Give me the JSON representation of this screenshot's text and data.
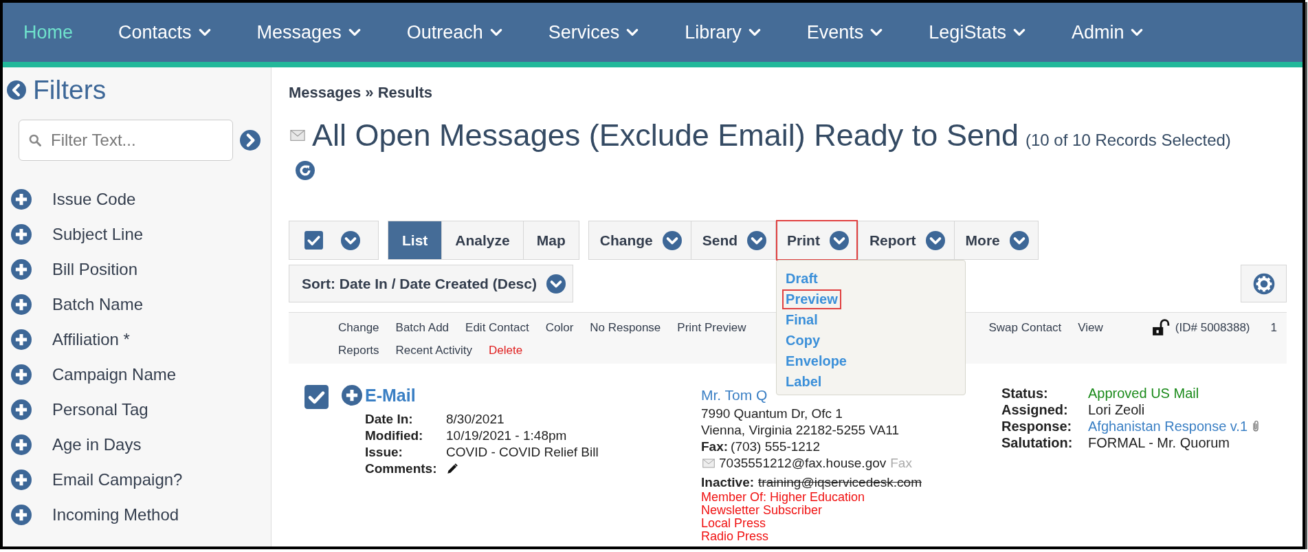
{
  "nav": [
    {
      "label": "Home",
      "selected": true,
      "dropdown": false
    },
    {
      "label": "Contacts",
      "selected": false,
      "dropdown": true
    },
    {
      "label": "Messages",
      "selected": false,
      "dropdown": true
    },
    {
      "label": "Outreach",
      "selected": false,
      "dropdown": true
    },
    {
      "label": "Services",
      "selected": false,
      "dropdown": true
    },
    {
      "label": "Library",
      "selected": false,
      "dropdown": true
    },
    {
      "label": "Events",
      "selected": false,
      "dropdown": true
    },
    {
      "label": "LegiStats",
      "selected": false,
      "dropdown": true
    },
    {
      "label": "Admin",
      "selected": false,
      "dropdown": true
    }
  ],
  "sidebar": {
    "title": "Filters",
    "search": {
      "placeholder": "Filter Text..."
    },
    "filters": [
      "Issue Code",
      "Subject Line",
      "Bill Position",
      "Batch Name",
      "Affiliation *",
      "Campaign Name",
      "Personal Tag",
      "Age in Days",
      "Email Campaign?",
      "Incoming Method"
    ]
  },
  "breadcrumb": "Messages » Results",
  "page_title": {
    "title": "All Open Messages (Exclude Email) Ready to Send",
    "count": "(10 of 10 Records Selected)"
  },
  "toolbar": {
    "select_all_checked": true,
    "views": [
      {
        "label": "List",
        "selected": true
      },
      {
        "label": "Analyze",
        "selected": false
      },
      {
        "label": "Map",
        "selected": false
      }
    ],
    "actions": [
      {
        "label": "Change",
        "highlighted": false
      },
      {
        "label": "Send",
        "highlighted": false
      },
      {
        "label": "Print",
        "highlighted": true
      },
      {
        "label": "Report",
        "highlighted": false
      },
      {
        "label": "More",
        "highlighted": false
      }
    ],
    "sort": "Sort: Date In / Date Created (Desc)"
  },
  "print_menu": {
    "items": [
      {
        "label": "Draft",
        "highlighted": false
      },
      {
        "label": "Preview",
        "highlighted": true
      },
      {
        "label": "Final",
        "highlighted": false
      },
      {
        "label": "Copy",
        "highlighted": false
      },
      {
        "label": "Envelope",
        "highlighted": false
      },
      {
        "label": "Label",
        "highlighted": false
      }
    ]
  },
  "record_actions": {
    "row_1": [
      {
        "label": "Change",
        "kind": "link"
      },
      {
        "label": "Batch Add",
        "kind": "link"
      },
      {
        "label": "Edit Contact",
        "kind": "link"
      },
      {
        "label": "Color",
        "kind": "link"
      },
      {
        "label": "No Response",
        "kind": "link"
      },
      {
        "label": "Print Preview",
        "kind": "link"
      },
      {
        "label": "Swap Contact",
        "kind": "link"
      },
      {
        "label": "View",
        "kind": "link"
      }
    ],
    "row_2": [
      {
        "label": "Reports",
        "kind": "link"
      },
      {
        "label": "Recent Activity",
        "kind": "link"
      },
      {
        "label": "Delete",
        "kind": "danger"
      }
    ],
    "id": "(ID# 5008388)",
    "number": "1"
  },
  "record": {
    "checked": true,
    "type": "E-Mail",
    "details": [
      {
        "label": "Date In:",
        "value": "8/30/2021",
        "kind": "text"
      },
      {
        "label": "Modified:",
        "value": "10/19/2021 - 1:48pm",
        "kind": "text"
      },
      {
        "label": "Issue:",
        "value": "COVID - COVID Relief Bill",
        "kind": "text"
      },
      {
        "label": "Comments:",
        "kind": "edit"
      }
    ],
    "contact": {
      "name": "Mr. Tom Q",
      "address_lines": [
        "7990 Quantum Dr, Ofc 1",
        "Vienna, Virginia 22182-5255 VA11"
      ],
      "fax_label": "Fax:",
      "fax": "(703) 555-1212",
      "email": "7035551212@fax.house.gov",
      "email_tag": "Fax",
      "inactive_label": "Inactive:",
      "inactive_email": "training@iqservicedesk.com",
      "tags": [
        "Member Of: Higher Education",
        "Newsletter Subscriber",
        "Local Press",
        "Radio Press"
      ]
    },
    "summary": [
      {
        "label": "Status:",
        "value": "Approved US Mail",
        "kind": "status",
        "attachment": false
      },
      {
        "label": "Assigned:",
        "value": "Lori Zeoli",
        "kind": "text",
        "attachment": false
      },
      {
        "label": "Response:",
        "value": "Afghanistan Response v.1",
        "kind": "link",
        "attachment": true
      },
      {
        "label": "Salutation:",
        "value": "FORMAL - Mr. Quorum",
        "kind": "text",
        "attachment": false
      }
    ]
  }
}
